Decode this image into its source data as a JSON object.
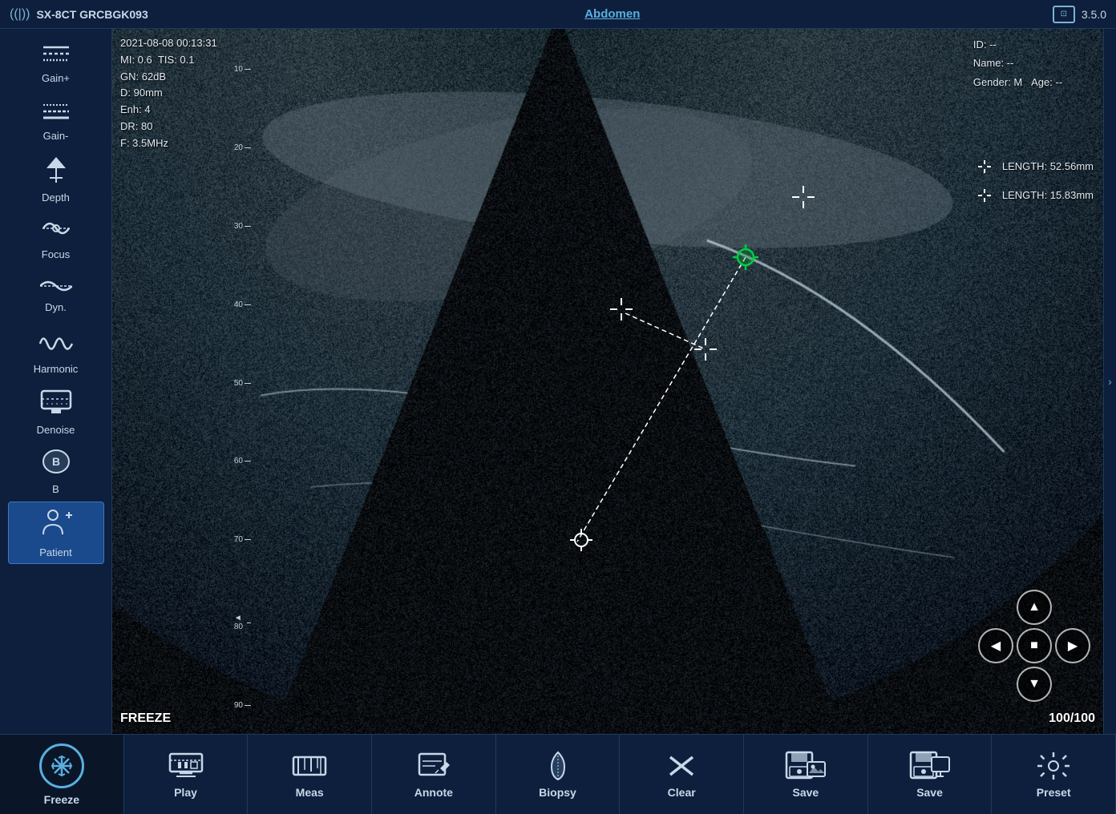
{
  "topbar": {
    "signal_icon": "((|))",
    "device_name": "SX-8CT GRCBGK093",
    "exam_type": "Abdomen",
    "version": "3.5.0",
    "monitor_icon": "⊡"
  },
  "sidebar": {
    "buttons": [
      {
        "id": "gain-plus",
        "label": "Gain+",
        "icon": "gain_plus"
      },
      {
        "id": "gain-minus",
        "label": "Gain-",
        "icon": "gain_minus"
      },
      {
        "id": "depth",
        "label": "Depth",
        "icon": "depth"
      },
      {
        "id": "focus",
        "label": "Focus",
        "icon": "focus"
      },
      {
        "id": "dyn",
        "label": "Dyn.",
        "icon": "dyn"
      },
      {
        "id": "harmonic",
        "label": "Harmonic",
        "icon": "harmonic"
      },
      {
        "id": "denoise",
        "label": "Denoise",
        "icon": "denoise"
      },
      {
        "id": "b-mode",
        "label": "B",
        "icon": "b_mode"
      },
      {
        "id": "patient",
        "label": "Patient",
        "icon": "patient"
      }
    ]
  },
  "image_overlay": {
    "datetime": "2021-08-08 00:13:31",
    "mi": "MI: 0.6",
    "tis": "TIS: 0.1",
    "gn": "GN: 62dB",
    "depth": "D: 90mm",
    "enh": "Enh: 4",
    "dr": "DR: 80",
    "freq": "F: 3.5MHz",
    "id_label": "ID: --",
    "name_label": "Name: --",
    "gender_label": "Gender: M",
    "age_label": "Age: --",
    "length1_label": "LENGTH: 52.56mm",
    "length2_label": "LENGTH: 15.83mm",
    "freeze_text": "FREEZE",
    "frame_counter": "100/100"
  },
  "depth_marks": [
    {
      "value": "10"
    },
    {
      "value": "20"
    },
    {
      "value": "30"
    },
    {
      "value": "40"
    },
    {
      "value": "50"
    },
    {
      "value": "60"
    },
    {
      "value": "70"
    },
    {
      "value": "80"
    },
    {
      "value": "90"
    }
  ],
  "playback": {
    "up_label": "▲",
    "left_label": "◀",
    "stop_label": "■",
    "right_label": "▶",
    "down_label": "▼"
  },
  "toolbar": {
    "buttons": [
      {
        "id": "freeze",
        "label": "Freeze",
        "icon": "freeze"
      },
      {
        "id": "play",
        "label": "Play",
        "icon": "play"
      },
      {
        "id": "meas",
        "label": "Meas",
        "icon": "meas"
      },
      {
        "id": "annote",
        "label": "Annote",
        "icon": "annote"
      },
      {
        "id": "biopsy",
        "label": "Biopsy",
        "icon": "biopsy"
      },
      {
        "id": "clear",
        "label": "Clear",
        "icon": "clear"
      },
      {
        "id": "save1",
        "label": "Save",
        "icon": "save1"
      },
      {
        "id": "save2",
        "label": "Save",
        "icon": "save2"
      },
      {
        "id": "preset",
        "label": "Preset",
        "icon": "preset"
      }
    ]
  },
  "colors": {
    "background": "#0a1628",
    "sidebar_bg": "#0d1f3c",
    "accent_blue": "#5aafe0",
    "text_light": "#c8d8e8",
    "border": "#1e3a5f",
    "green_crosshair": "#00cc44"
  }
}
